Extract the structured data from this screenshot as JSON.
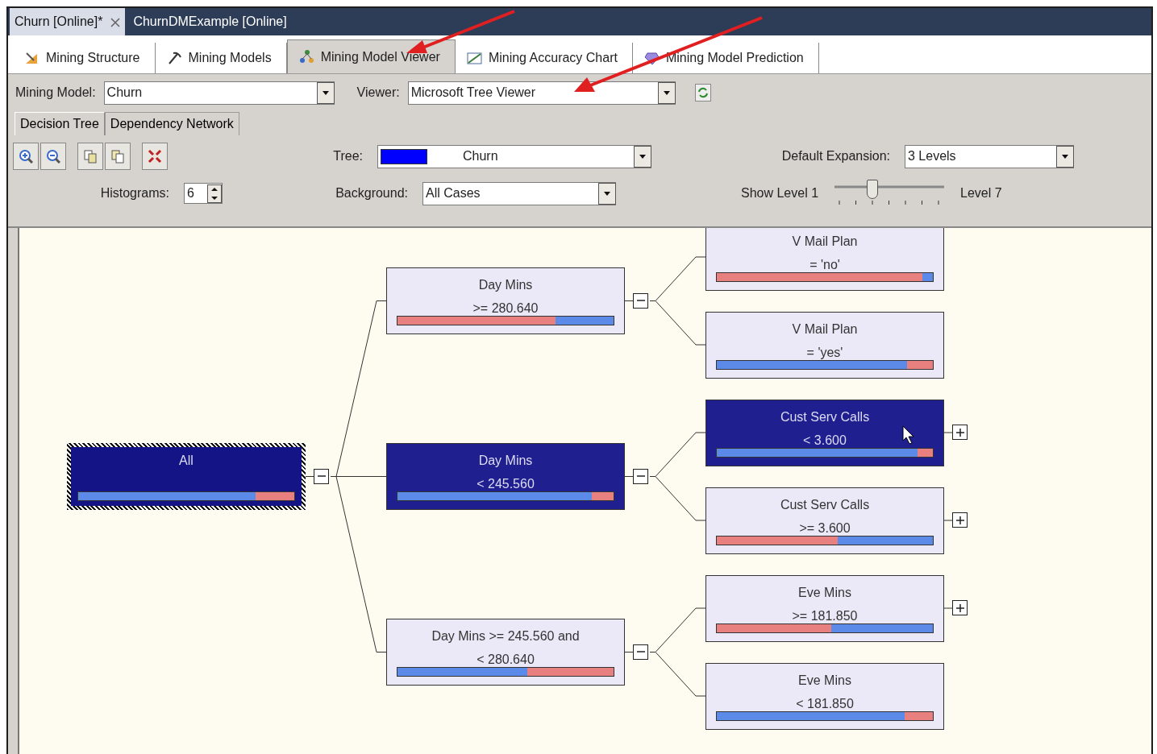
{
  "document_tabs": [
    {
      "label": "Churn [Online]*",
      "selected": true,
      "closable": true
    },
    {
      "label": "ChurnDMExample [Online]",
      "selected": false,
      "closable": false
    }
  ],
  "designer_tabs": [
    {
      "label": "Mining Structure",
      "selected": false,
      "kind": "structure"
    },
    {
      "label": "Mining Models",
      "selected": false,
      "kind": "models"
    },
    {
      "label": "Mining Model Viewer",
      "selected": true,
      "kind": "viewer"
    },
    {
      "label": "Mining Accuracy Chart",
      "selected": false,
      "kind": "accuracy"
    },
    {
      "label": "Mining Model Prediction",
      "selected": false,
      "kind": "prediction"
    }
  ],
  "mining_model": {
    "label": "Mining Model:",
    "value": "Churn"
  },
  "viewer": {
    "label": "Viewer:",
    "value": "Microsoft Tree Viewer"
  },
  "view_tabs": [
    {
      "label": "Decision Tree",
      "selected": true
    },
    {
      "label": "Dependency Network",
      "selected": false
    }
  ],
  "tree_selector": {
    "label": "Tree:",
    "value": "Churn",
    "color": "#0000ff"
  },
  "default_expansion": {
    "label": "Default Expansion:",
    "value": "3 Levels"
  },
  "histograms": {
    "label": "Histograms:",
    "value": "6"
  },
  "background": {
    "label": "Background:",
    "value": "All Cases"
  },
  "show_level": {
    "label_min": "Show Level 1",
    "label_max": "Level 7",
    "level": 0.33
  },
  "tree": {
    "lines": [
      "All"
    ],
    "selected": true,
    "highlighted": true,
    "expanded": true,
    "histogram": [
      {
        "color": "#5b8ae8",
        "level": 0.82
      },
      {
        "color": "#e98080",
        "level": 0.18
      }
    ],
    "children": [
      {
        "lines": [
          "Day Mins",
          ">= 280.640"
        ],
        "selected": false,
        "highlighted": false,
        "expanded": true,
        "histogram": [
          {
            "color": "#e98080",
            "level": 0.73
          },
          {
            "color": "#5b8ae8",
            "level": 0.27
          }
        ],
        "children": [
          {
            "lines": [
              "V Mail Plan",
              "= 'no'"
            ],
            "selected": false,
            "highlighted": false,
            "histogram": [
              {
                "color": "#e98080",
                "level": 0.95
              },
              {
                "color": "#5b8ae8",
                "level": 0.05
              }
            ]
          },
          {
            "lines": [
              "V Mail Plan",
              "= 'yes'"
            ],
            "selected": false,
            "highlighted": false,
            "histogram": [
              {
                "color": "#5b8ae8",
                "level": 0.88
              },
              {
                "color": "#e98080",
                "level": 0.12
              }
            ]
          }
        ]
      },
      {
        "lines": [
          "Day Mins",
          "< 245.560"
        ],
        "selected": false,
        "highlighted": true,
        "expanded": true,
        "histogram": [
          {
            "color": "#5b8ae8",
            "level": 0.9
          },
          {
            "color": "#e98080",
            "level": 0.1
          }
        ],
        "children": [
          {
            "lines": [
              "Cust Serv Calls",
              "< 3.600"
            ],
            "selected": false,
            "highlighted": true,
            "expanded": false,
            "histogram": [
              {
                "color": "#5b8ae8",
                "level": 0.93
              },
              {
                "color": "#e98080",
                "level": 0.07
              }
            ]
          },
          {
            "lines": [
              "Cust Serv Calls",
              ">= 3.600"
            ],
            "selected": false,
            "highlighted": false,
            "expanded": false,
            "histogram": [
              {
                "color": "#e98080",
                "level": 0.56
              },
              {
                "color": "#5b8ae8",
                "level": 0.44
              }
            ]
          }
        ]
      },
      {
        "lines": [
          "Day Mins >= 245.560 and",
          "< 280.640"
        ],
        "selected": false,
        "highlighted": false,
        "expanded": true,
        "histogram": [
          {
            "color": "#5b8ae8",
            "level": 0.6
          },
          {
            "color": "#e98080",
            "level": 0.4
          }
        ],
        "children": [
          {
            "lines": [
              "Eve Mins",
              ">= 181.850"
            ],
            "selected": false,
            "highlighted": false,
            "expanded": false,
            "histogram": [
              {
                "color": "#e98080",
                "level": 0.53
              },
              {
                "color": "#5b8ae8",
                "level": 0.47
              }
            ]
          },
          {
            "lines": [
              "Eve Mins",
              "< 181.850"
            ],
            "selected": false,
            "highlighted": false,
            "histogram": [
              {
                "color": "#5b8ae8",
                "level": 0.87
              },
              {
                "color": "#e98080",
                "level": 0.13
              }
            ]
          }
        ]
      }
    ]
  }
}
